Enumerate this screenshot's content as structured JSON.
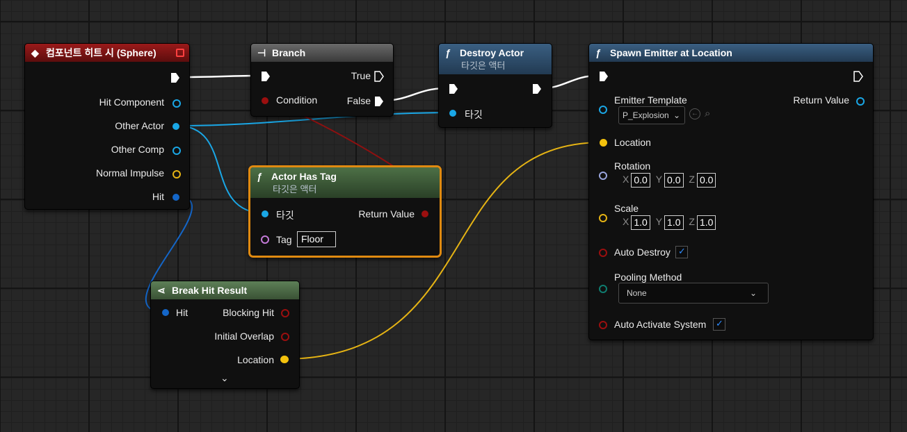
{
  "colors": {
    "event_header": "#8b1515",
    "branch_header": "#5a5a5a",
    "function_header": "#2f4d68",
    "pure_header": "#3e5a38",
    "break_header": "#4d6a48",
    "selected_border": "#e08a10",
    "object_pin": "#1aa7e6",
    "struct_pin": "#1466c8",
    "bool_pin": "#9b0f0f",
    "vector_pin": "#f4c20d",
    "rotator_pin": "#9aa6de",
    "name_pin": "#c47ad8",
    "float_pin": "#7ec832",
    "byte_pin": "#0f7d70",
    "exec_wire": "#ffffff"
  },
  "event_node": {
    "title": "컴포넌트 히트 시 (Sphere)",
    "icon": "event-diamond-icon",
    "outputs": [
      "Hit Component",
      "Other Actor",
      "Other Comp",
      "Normal Impulse",
      "Hit"
    ]
  },
  "branch_node": {
    "title": "Branch",
    "icon": "branch-icon",
    "condition_label": "Condition",
    "true_label": "True",
    "false_label": "False"
  },
  "destroy_node": {
    "title": "Destroy Actor",
    "subtitle": "타깃은 액터",
    "target_label": "타깃"
  },
  "spawn_node": {
    "title": "Spawn Emitter at Location",
    "emitter_label": "Emitter Template",
    "emitter_value": "P_Explosion",
    "return_label": "Return Value",
    "location_label": "Location",
    "rotation_label": "Rotation",
    "rotation": {
      "x": "0.0",
      "y": "0.0",
      "z": "0.0"
    },
    "scale_label": "Scale",
    "scale": {
      "x": "1.0",
      "y": "1.0",
      "z": "1.0"
    },
    "axis_x": "X",
    "axis_y": "Y",
    "axis_z": "Z",
    "auto_destroy_label": "Auto Destroy",
    "auto_destroy": true,
    "pooling_label": "Pooling Method",
    "pooling_value": "None",
    "auto_activate_label": "Auto Activate System",
    "auto_activate": true
  },
  "tag_node": {
    "title": "Actor Has Tag",
    "subtitle": "타깃은 액터",
    "target_label": "타깃",
    "return_label": "Return Value",
    "tag_label": "Tag",
    "tag_value": "Floor"
  },
  "break_node": {
    "title": "Break Hit Result",
    "hit_label": "Hit",
    "outputs": [
      "Blocking Hit",
      "Initial Overlap",
      "Location"
    ]
  }
}
